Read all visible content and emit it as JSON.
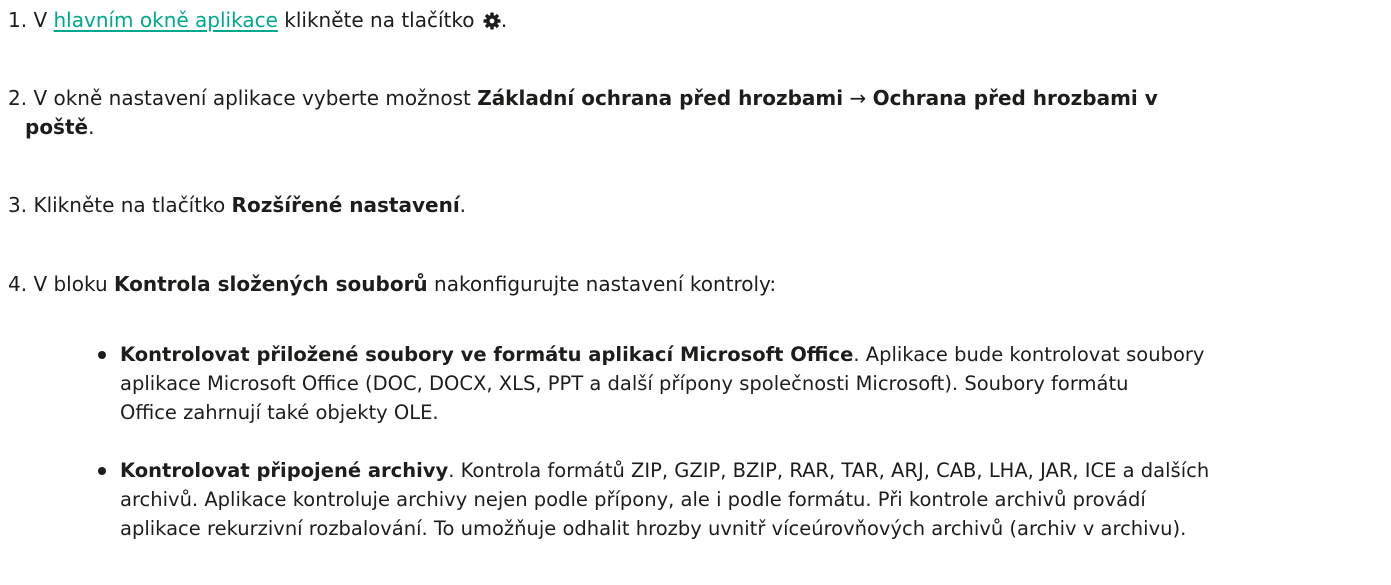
{
  "steps": [
    {
      "num": "1.",
      "pre": " V ",
      "link": "hlavním okně aplikace",
      "post": " klikněte na tlačítko ",
      "icon": "gear-icon",
      "end": "."
    },
    {
      "num": "2.",
      "pre": " V okně nastavení aplikace vyberte možnost ",
      "bold1": "Základní ochrana před hrozbami",
      "arrow": " → ",
      "bold2a": "Ochrana před hrozbami v",
      "bold2b": "poště",
      "end": "."
    },
    {
      "num": "3.",
      "pre": " Klikněte na tlačítko ",
      "bold": "Rozšířené nastavení",
      "end": "."
    },
    {
      "num": "4.",
      "pre": " V bloku ",
      "bold": "Kontrola složených souborů",
      "post": " nakonfigurujte nastavení kontroly:"
    }
  ],
  "options": [
    {
      "title": "Kontrolovat přiložené soubory ve formátu aplikací Microsoft Office",
      "line1": ". Aplikace bude kontrolovat soubory",
      "line2": "aplikace Microsoft Office (DOC, DOCX, XLS, PPT a další přípony společnosti Microsoft). Soubory formátu",
      "line3": "Office zahrnují také objekty OLE."
    },
    {
      "title": "Kontrolovat připojené archivy",
      "line1": ". Kontrola formátů ZIP, GZIP, BZIP, RAR, TAR, ARJ, CAB, LHA, JAR, ICE a dalších",
      "line2": "archivů. Aplikace kontroluje archivy nejen podle přípony, ale i podle formátu. Při kontrole archivů provádí",
      "line3": "aplikace rekurzivní rozbalování. To umožňuje odhalit hrozby uvnitř víceúrovňových archivů (archiv v archivu)."
    }
  ],
  "colors": {
    "link": "#00a88e",
    "text": "#1d1d1b"
  }
}
